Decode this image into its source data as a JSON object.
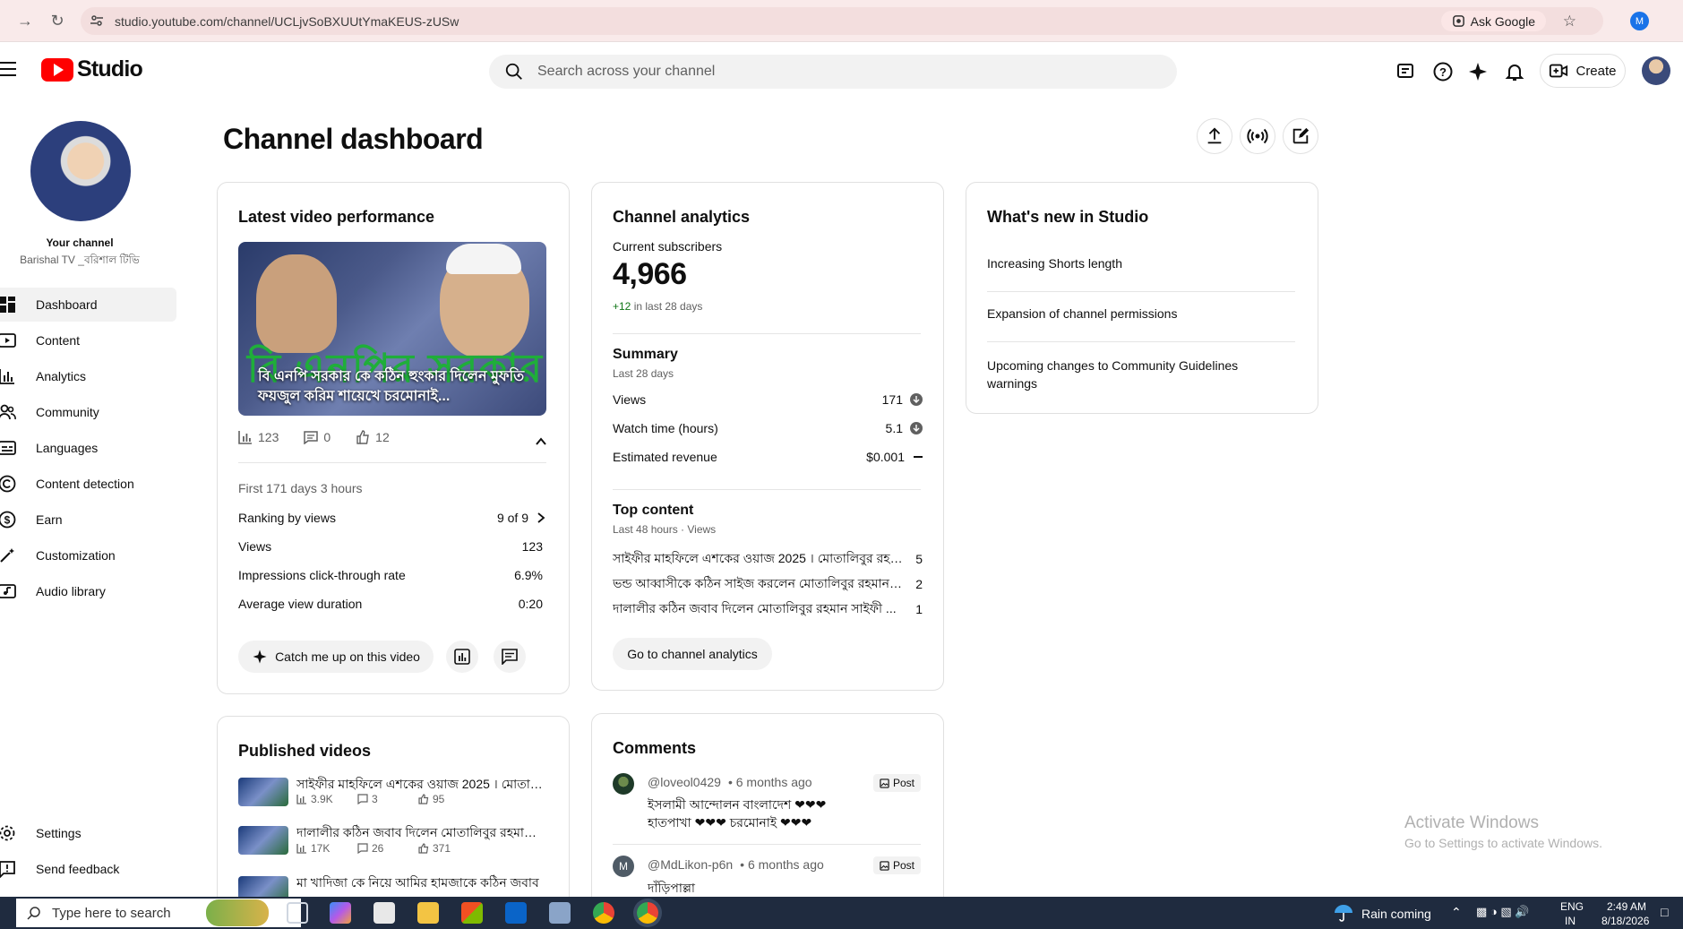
{
  "browser": {
    "url": "studio.youtube.com/channel/UCLjvSoBXUUtYmaKEUS-zUSw",
    "ask_google": "Ask Google",
    "profile_initial": "M"
  },
  "header": {
    "logo_text": "Studio",
    "search_placeholder": "Search across your channel",
    "create_label": "Create"
  },
  "sidebar": {
    "your_channel": "Your channel",
    "channel_name": "Barishal TV _বরিশাল টিভি",
    "items": [
      {
        "label": "Dashboard"
      },
      {
        "label": "Content"
      },
      {
        "label": "Analytics"
      },
      {
        "label": "Community"
      },
      {
        "label": "Languages"
      },
      {
        "label": "Content detection"
      },
      {
        "label": "Earn"
      },
      {
        "label": "Customization"
      },
      {
        "label": "Audio library"
      }
    ],
    "settings": "Settings",
    "feedback": "Send feedback"
  },
  "page": {
    "title": "Channel dashboard"
  },
  "latest_video": {
    "title": "Latest video performance",
    "thumb_title": "বি এনপি সরকার কে কঠিন হুংকার দিলেন মুফতি ফয়জুল করিম শায়েখে চরমোনাই...",
    "thumb_overlay": "বি এনপির সরকার কে",
    "views_count": "123",
    "comments_count": "0",
    "likes_count": "12",
    "period": "First 171 days 3 hours",
    "rows": [
      {
        "label": "Ranking by views",
        "value": "9 of 9"
      },
      {
        "label": "Views",
        "value": "123"
      },
      {
        "label": "Impressions click-through rate",
        "value": "6.9%"
      },
      {
        "label": "Average view duration",
        "value": "0:20"
      }
    ],
    "catch_up": "Catch me up on this video"
  },
  "analytics": {
    "title": "Channel analytics",
    "subs_label": "Current subscribers",
    "subs_value": "4,966",
    "subs_delta": "+12",
    "subs_delta_suffix": " in last 28 days",
    "summary_title": "Summary",
    "summary_period": "Last 28 days",
    "summary": [
      {
        "label": "Views",
        "value": "171"
      },
      {
        "label": "Watch time (hours)",
        "value": "5.1"
      },
      {
        "label": "Estimated revenue",
        "value": "$0.001"
      }
    ],
    "top_title": "Top content",
    "top_period": "Last 48 hours · Views",
    "top": [
      {
        "title": "সাইফীর মাহফিলে এশকের ওয়াজ 2025 । মোতালিবুর রহমান সাইফী",
        "value": "5"
      },
      {
        "title": "ভন্ড আব্বাসীকে কঠিন সাইজ করলেন মোতালিবুর রহমান সাইফী",
        "value": "2"
      },
      {
        "title": "দালালীর কঠিন জবাব দিলেন মোতালিবুর রহমান সাইফী ...",
        "value": "1"
      }
    ],
    "go_btn": "Go to channel analytics"
  },
  "whats_new": {
    "title": "What's new in Studio",
    "items": [
      "Increasing Shorts length",
      "Expansion of channel permissions",
      "Upcoming changes to Community Guidelines warnings"
    ]
  },
  "published": {
    "title": "Published videos",
    "items": [
      {
        "title": "সাইফীর মাহফিলে এশকের ওয়াজ 2025 । মোতালিবুর রহমান",
        "views": "3.9K",
        "comments": "3",
        "likes": "95"
      },
      {
        "title": "দালালীর কঠিন জবাব দিলেন মোতালিবুর রহমান সাইফী",
        "views": "17K",
        "comments": "26",
        "likes": "371"
      },
      {
        "title": "মা খাদিজা কে নিয়ে আমির হামজাকে কঠিন জবাব",
        "views": "",
        "comments": "",
        "likes": ""
      }
    ]
  },
  "comments": {
    "title": "Comments",
    "items": [
      {
        "author": "@loveol0429",
        "time": "• 6 months ago",
        "badge": "Post",
        "text": "ইসলামী আন্দোলন বাংলাদেশ ❤❤❤ হাতপাখা ❤❤❤ চরমোনাই ❤❤❤"
      },
      {
        "author": "@MdLikon-p6n",
        "time": "• 6 months ago",
        "badge": "Post",
        "text": "দাঁড়িপাল্লা",
        "initial": "M"
      }
    ]
  },
  "watermark": {
    "line1": "Activate Windows",
    "line2": "Go to Settings to activate Windows."
  },
  "taskbar": {
    "search": "Type here to search",
    "weather": "Rain coming",
    "lang1": "ENG",
    "lang2": "IN",
    "time": "2:49 AM",
    "date": "8/18/2026"
  },
  "colors": {
    "brand_red": "#ff0000",
    "positive": "#107516",
    "taskbar": "#1f2b3f"
  }
}
